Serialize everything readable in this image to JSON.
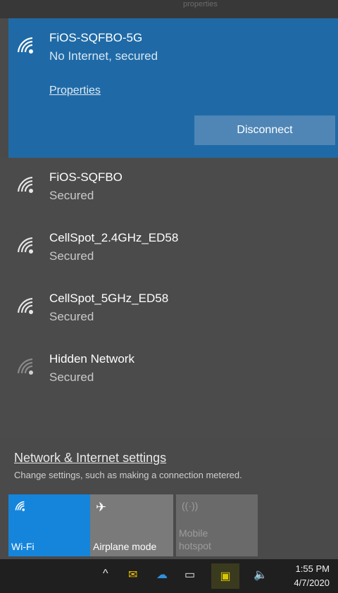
{
  "top_strip_text": "properties",
  "connected": {
    "ssid": "FiOS-SQFBO-5G",
    "status": "No Internet, secured",
    "properties_label": "Properties",
    "disconnect_label": "Disconnect"
  },
  "networks": [
    {
      "ssid": "FiOS-SQFBO",
      "status": "Secured"
    },
    {
      "ssid": "CellSpot_2.4GHz_ED58",
      "status": "Secured"
    },
    {
      "ssid": "CellSpot_5GHz_ED58",
      "status": "Secured"
    },
    {
      "ssid": "Hidden Network",
      "status": "Secured"
    }
  ],
  "settings": {
    "link_label": "Network & Internet settings",
    "description": "Change settings, such as making a connection metered."
  },
  "quick_actions": {
    "wifi_label": "Wi-Fi",
    "airplane_label": "Airplane mode",
    "hotspot_line1": "Mobile",
    "hotspot_line2": "hotspot"
  },
  "taskbar": {
    "time": "1:55 PM",
    "date": "4/7/2020"
  },
  "colors": {
    "accent": "#1f6aa6",
    "wifi_tile": "#1585dc",
    "flyout_bg": "#4b4b4b"
  }
}
